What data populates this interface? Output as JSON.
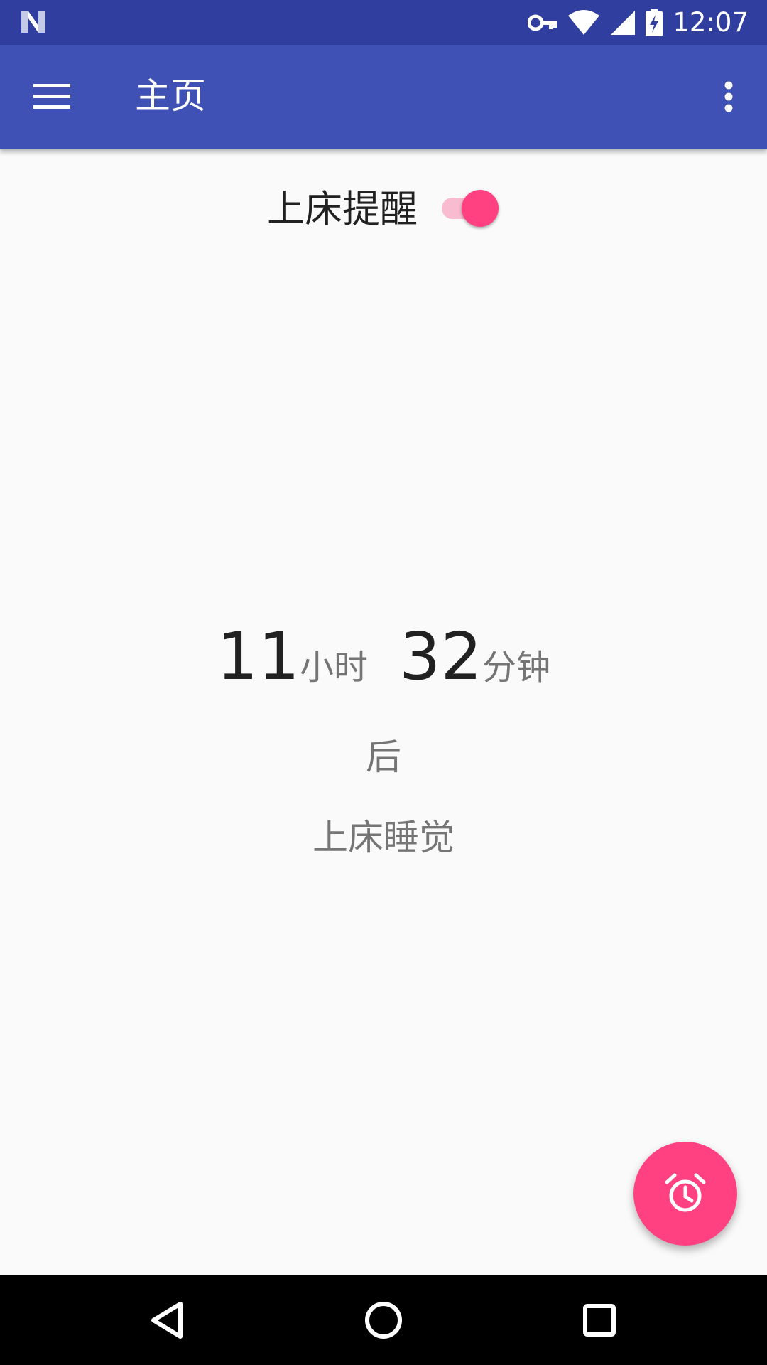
{
  "status_bar": {
    "time": "12:07",
    "icons": [
      "notification-n-icon",
      "vpn-key-icon",
      "wifi-icon",
      "cell-signal-icon",
      "battery-charging-icon"
    ]
  },
  "app_bar": {
    "title": "主页",
    "menu_icon": "hamburger-menu-icon",
    "more_icon": "more-vert-icon",
    "color": "#3f51b5",
    "status_color": "#303f9f"
  },
  "reminder": {
    "label": "上床提醒",
    "enabled": true,
    "accent_color": "#ff4081"
  },
  "countdown": {
    "hours": "11",
    "hours_unit": "小时",
    "minutes": "32",
    "minutes_unit": "分钟",
    "after": "后",
    "action": "上床睡觉"
  },
  "fab": {
    "icon": "alarm-icon",
    "color": "#ff4081"
  },
  "nav_bar": {
    "buttons": [
      "back-icon",
      "home-icon",
      "recents-icon"
    ]
  }
}
